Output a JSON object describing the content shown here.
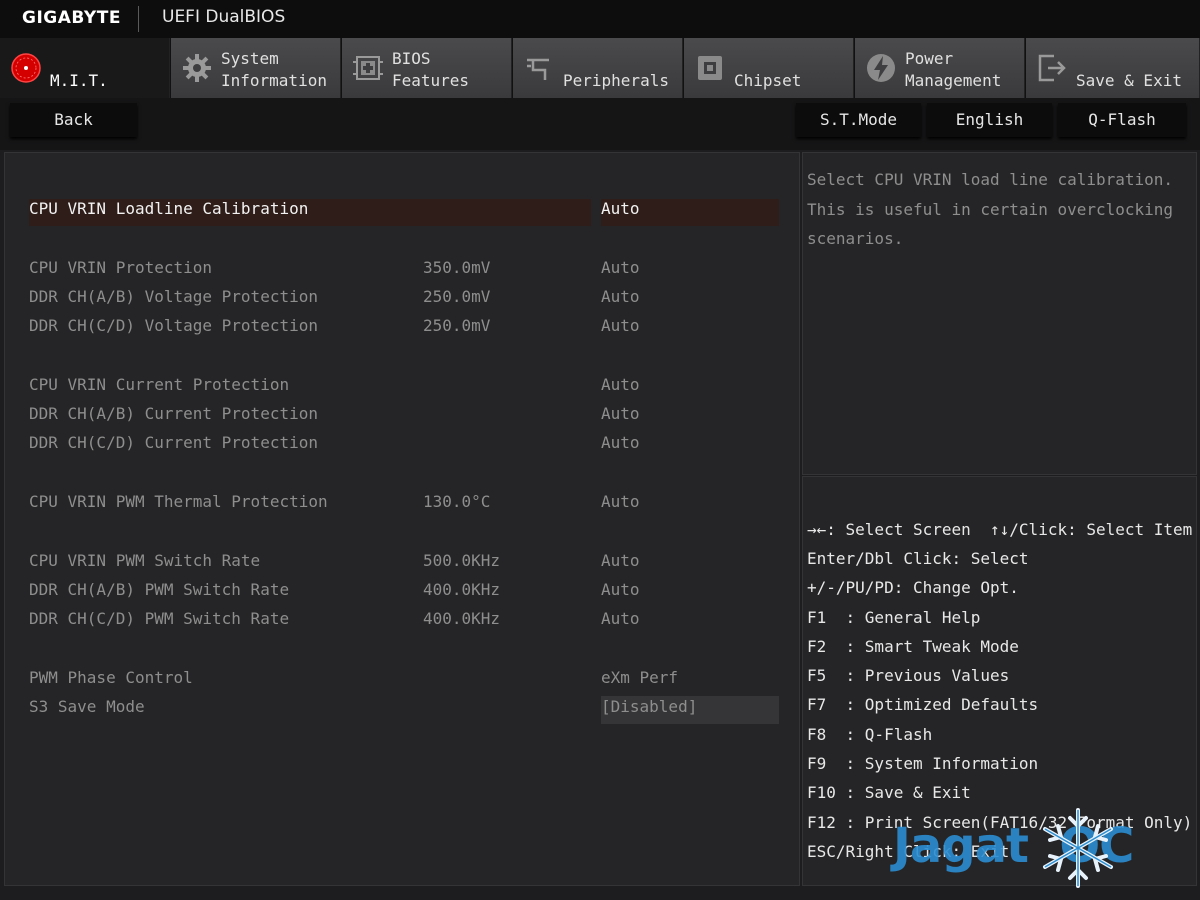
{
  "title_bar": {
    "brand": "GIGABYTE",
    "product": "UEFI DualBIOS"
  },
  "tabs": [
    {
      "icon": "mit-dial-icon",
      "line1": "",
      "line2": "M.I.T.",
      "active": true
    },
    {
      "icon": "gear-icon",
      "line1": "System",
      "line2": "Information",
      "active": false
    },
    {
      "icon": "bios-chip-plus-icon",
      "line1": "BIOS",
      "line2": "Features",
      "active": false
    },
    {
      "icon": "plug-icon",
      "line1": "",
      "line2": "Peripherals",
      "active": false
    },
    {
      "icon": "chipset-icon",
      "line1": "",
      "line2": "Chipset",
      "active": false
    },
    {
      "icon": "power-bolt-icon",
      "line1": "Power",
      "line2": "Management",
      "active": false
    },
    {
      "icon": "exit-door-icon",
      "line1": "",
      "line2": "Save & Exit",
      "active": false
    }
  ],
  "buttons": {
    "back": "Back",
    "st_mode": "S.T.Mode",
    "language": "English",
    "qflash": "Q-Flash"
  },
  "settings": [
    {
      "name": "CPU VRIN Loadline Calibration",
      "value": "",
      "setting": "Auto",
      "selected": true
    },
    {
      "name": "CPU VRIN Protection",
      "value": "350.0mV",
      "setting": "Auto"
    },
    {
      "name": "DDR CH(A/B) Voltage Protection",
      "value": "250.0mV",
      "setting": "Auto"
    },
    {
      "name": "DDR CH(C/D) Voltage Protection",
      "value": "250.0mV",
      "setting": "Auto"
    },
    {
      "name": "CPU VRIN Current Protection",
      "value": "",
      "setting": "Auto"
    },
    {
      "name": "DDR CH(A/B) Current Protection",
      "value": "",
      "setting": "Auto"
    },
    {
      "name": "DDR CH(C/D) Current Protection",
      "value": "",
      "setting": "Auto"
    },
    {
      "name": "CPU VRIN PWM Thermal Protection",
      "value": "130.0°C",
      "setting": "Auto"
    },
    {
      "name": "CPU VRIN PWM Switch Rate",
      "value": "500.0KHz",
      "setting": "Auto"
    },
    {
      "name": "DDR CH(A/B) PWM Switch Rate",
      "value": "400.0KHz",
      "setting": "Auto"
    },
    {
      "name": "DDR CH(C/D) PWM Switch Rate",
      "value": "400.0KHz",
      "setting": "Auto"
    },
    {
      "name": "PWM Phase Control",
      "value": "",
      "setting": "eXm Perf"
    },
    {
      "name": "S3 Save Mode",
      "value": "",
      "setting": "[Disabled]"
    }
  ],
  "help": {
    "text": "Select CPU VRIN load line calibration. This is useful in certain overclocking scenarios."
  },
  "keys": [
    "→←: Select Screen  ↑↓/Click: Select Item",
    "Enter/Dbl Click: Select",
    "+/-/PU/PD: Change Opt.",
    "F1  : General Help",
    "F2  : Smart Tweak Mode",
    "F5  : Previous Values",
    "F7  : Optimized Defaults",
    "F8  : Q-Flash",
    "F9  : System Information",
    "F10 : Save & Exit",
    "F12 : Print Screen(FAT16/32 Format Only)",
    "ESC/Right Click: Exit"
  ],
  "watermark": {
    "text": "Jagat  OC"
  },
  "colors": {
    "selected_row_bg": "#2e1d19",
    "active_tab_icon": "#e00000",
    "watermark": "#2b8ed1"
  }
}
